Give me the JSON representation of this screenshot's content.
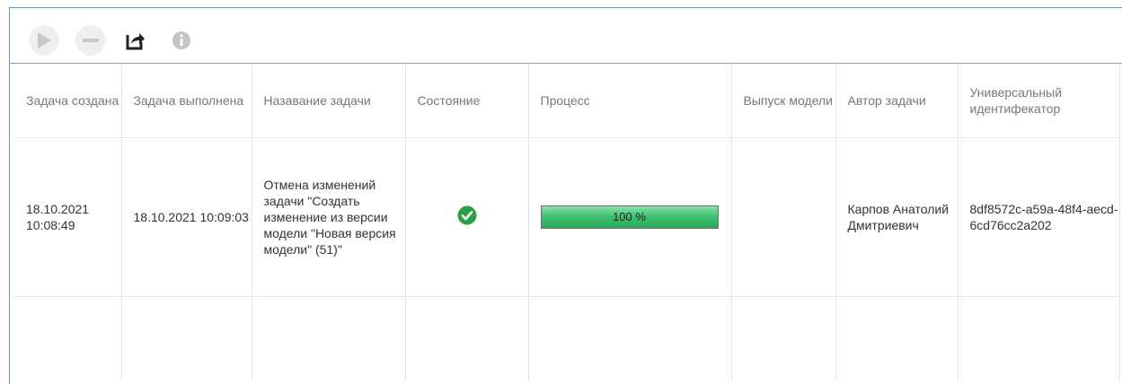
{
  "toolbar": {
    "icons": [
      "play-icon",
      "minus-icon",
      "export-icon",
      "info-icon"
    ]
  },
  "table": {
    "headers": {
      "created": "Задача создана",
      "completed": "Задача выполнена",
      "name": "Назавание задачи",
      "state": "Состояние",
      "process": "Процесс",
      "release": "Выпуск модели",
      "author": "Автор задачи",
      "uid": "Универсальный идентифекатор"
    },
    "rows": [
      {
        "created": "18.10.2021 10:08:49",
        "completed": "18.10.2021 10:09:03",
        "name": "Отмена изменений задачи \"Создать изменение из версии модели \"Новая версия модели\" (51)\"",
        "state_icon": "check-circle-icon",
        "progress": 100,
        "progress_label": "100 %",
        "release": "",
        "author": "Карпов Анатолий Дмитриевич",
        "uid": "8df8572c-a59a-48f4-aecd-6cd76cc2a202"
      }
    ]
  },
  "colors": {
    "frame_border": "#5b9bd5",
    "progress_green": "#3fc271",
    "check_green": "#2e9e48",
    "disabled_icon": "#c4c4c4"
  }
}
